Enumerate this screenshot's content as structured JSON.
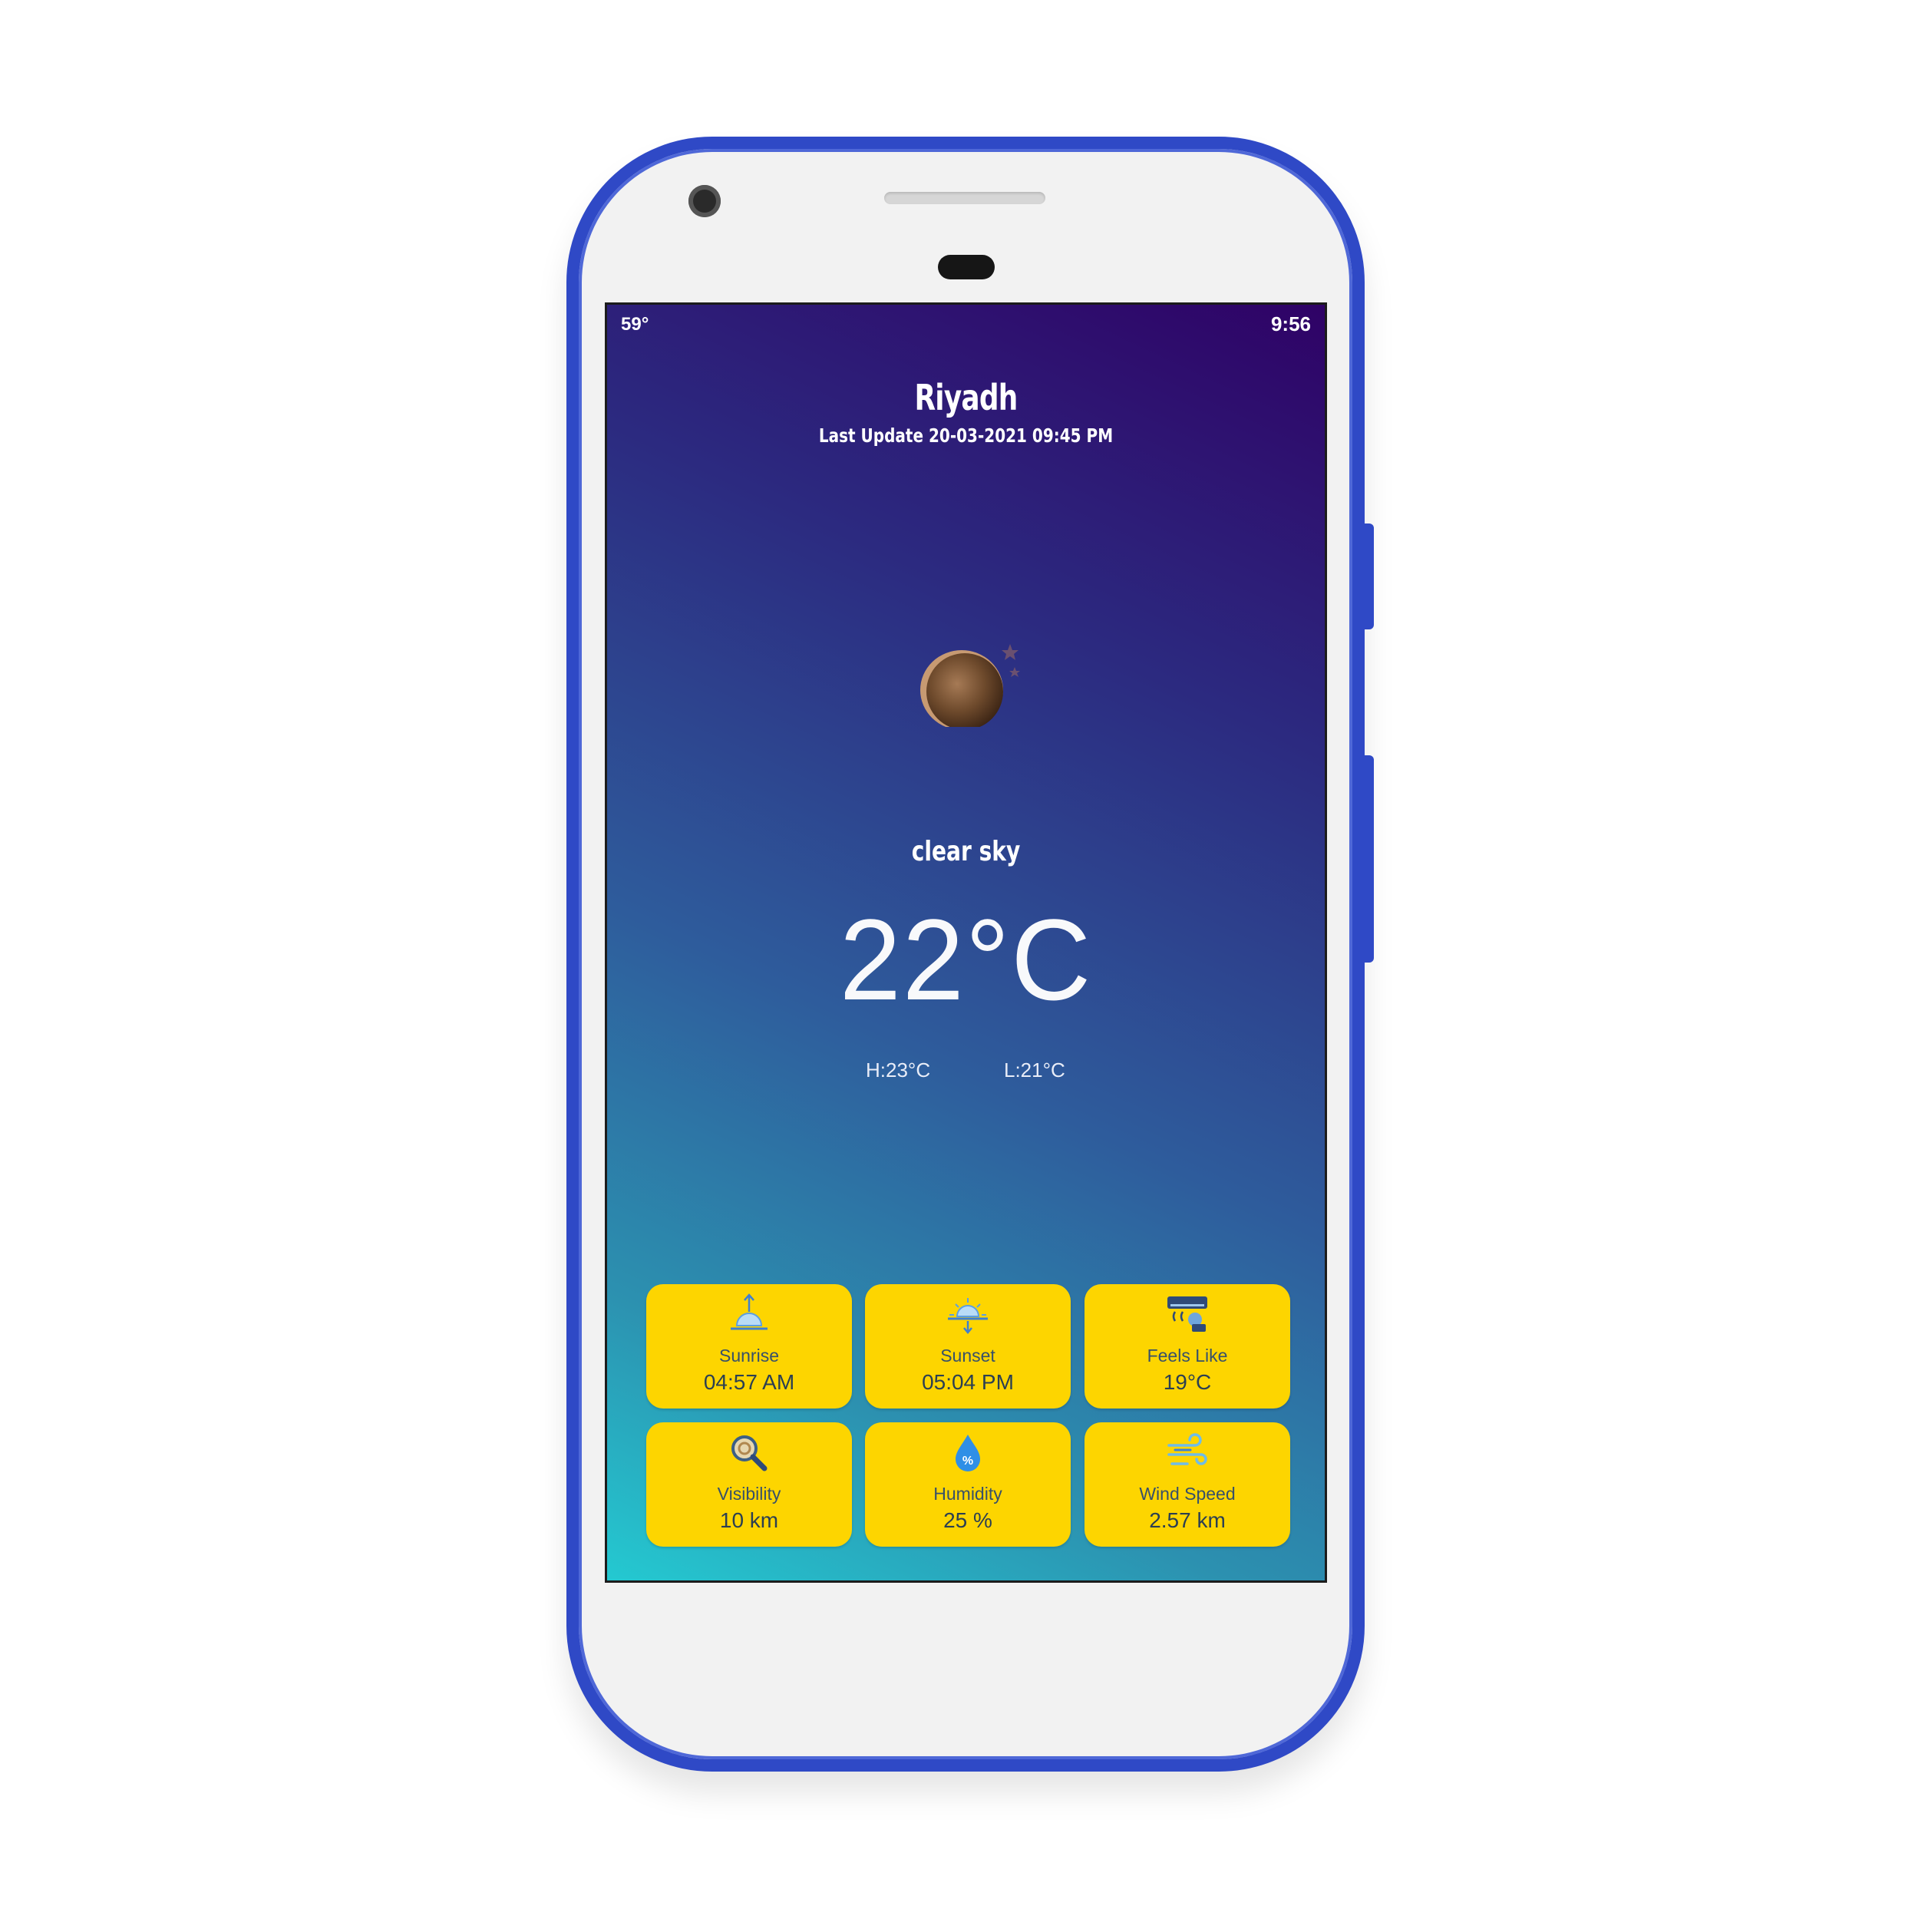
{
  "status_bar": {
    "temp": "59°",
    "time": "9:56"
  },
  "location": {
    "city": "Riyadh",
    "last_update": "Last Update 20-03-2021 09:45 PM"
  },
  "current": {
    "condition": "clear sky",
    "temperature": "22°C",
    "high": "H:23°C",
    "low": "L:21°C"
  },
  "tiles": [
    {
      "label": "Sunrise",
      "value": "04:57 AM",
      "icon": "sunrise-icon"
    },
    {
      "label": "Sunset",
      "value": "05:04 PM",
      "icon": "sunset-icon"
    },
    {
      "label": "Feels Like",
      "value": "19°C",
      "icon": "air-conditioner-icon"
    },
    {
      "label": "Visibility",
      "value": "10 km",
      "icon": "visibility-magnifier-icon"
    },
    {
      "label": "Humidity",
      "value": "25 %",
      "icon": "humidity-drop-icon"
    },
    {
      "label": "Wind Speed",
      "value": "2.57 km",
      "icon": "wind-icon"
    }
  ],
  "colors": {
    "phone_frame": "#2f49c6",
    "tile_background": "#fdd500",
    "gradient_top": "#2f0266",
    "gradient_bottom": "#24c9d1"
  }
}
